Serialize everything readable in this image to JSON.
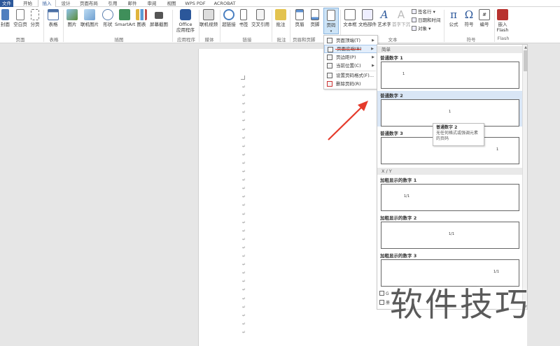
{
  "tabs": [
    "文件",
    "开始",
    "插入",
    "设计",
    "页面布局",
    "引用",
    "邮件",
    "审阅",
    "视图",
    "WPS PDF",
    "ACROBAT"
  ],
  "ribbon": {
    "cover": "封面",
    "blank_page": "空白页",
    "page_break": "分页",
    "table": "表格",
    "picture": "图片",
    "online_picture": "联机图片",
    "shapes": "形状",
    "smartart": "SmartArt",
    "chart": "图表",
    "screenshot": "屏幕截图",
    "office_apps": [
      "Office",
      "应用程序"
    ],
    "online_video": "联机视频",
    "hyperlink": "超链接",
    "bookmark": "书签",
    "cross_ref": "交叉引用",
    "comment": "批注",
    "header": "页眉",
    "footer": "页脚",
    "page_number": "页码",
    "textbox": "文本框",
    "quick_parts": "文档部件",
    "wordart": "艺术字",
    "dropcap": "首字下沉",
    "signature_line": "签名行",
    "date_time": "日期和时间",
    "object": "对象",
    "equation": "公式",
    "symbol": "符号",
    "number": "编号",
    "embed_flash": [
      "嵌入",
      "Flash"
    ],
    "groups": {
      "pages": "页面",
      "tables": "表格",
      "illustrations": "插图",
      "apps": "应用程序",
      "media": "媒体",
      "links": "链接",
      "comments": "批注",
      "header_footer": "页眉和页脚",
      "text": "文本",
      "symbols": "符号",
      "flash": "Flash"
    }
  },
  "menu": {
    "items": [
      {
        "label": "页面顶端(T)",
        "submenu": true
      },
      {
        "label": "页面底端(B)",
        "submenu": true,
        "highlighted": true
      },
      {
        "label": "页边距(P)",
        "submenu": true
      },
      {
        "label": "当前位置(C)",
        "submenu": true
      },
      {
        "label": "设置页码格式(F)...",
        "submenu": false
      },
      {
        "label": "删除页码(R)",
        "submenu": false
      }
    ]
  },
  "gallery": {
    "section_simple": "简单",
    "items": [
      {
        "title": "普通数字 1",
        "num": "1"
      },
      {
        "title": "普通数字 2",
        "num": "1",
        "highlighted": true
      },
      {
        "title": "普通数字 3",
        "num": "1"
      }
    ],
    "section_xy": "X / Y",
    "bold_items": [
      {
        "title": "加粗显示的数字 1",
        "num": "1/1"
      },
      {
        "title": "加粗显示的数字 2",
        "num": "1/1"
      },
      {
        "title": "加粗显示的数字 3",
        "num": "1/1"
      }
    ],
    "more1": "G",
    "more2": "册"
  },
  "tooltip": {
    "title": "普通数字 2",
    "body": "无任何格式或强调元素的页码"
  },
  "document": {
    "para_mark": "↵"
  },
  "watermark": "软件技巧",
  "colors": {
    "accent": "#2b579a",
    "highlight": "#d9e6f6",
    "arrow": "#e53a2b"
  }
}
